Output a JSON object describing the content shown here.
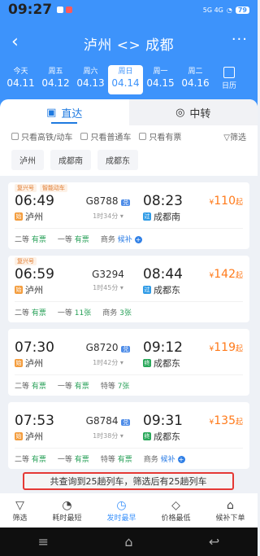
{
  "status": {
    "time": "09:27",
    "signal": "5G 4G",
    "battery": "79"
  },
  "title": "泸州 <> 成都",
  "header": {
    "back": "‹",
    "more": "···"
  },
  "dates": [
    {
      "w": "今天",
      "d": "04.11",
      "active": false
    },
    {
      "w": "周五",
      "d": "04.12",
      "active": false
    },
    {
      "w": "周六",
      "d": "04.13",
      "active": false
    },
    {
      "w": "周日",
      "d": "04.14",
      "active": true
    },
    {
      "w": "周一",
      "d": "04.15",
      "active": false
    },
    {
      "w": "周二",
      "d": "04.16",
      "active": false
    }
  ],
  "calendar_label": "日历",
  "tabs": {
    "direct": "直达",
    "transfer": "中转"
  },
  "filters": {
    "gaotie": "只看高铁/动车",
    "putong": "只看普通车",
    "youpiao": "只看有票",
    "screen": "筛选"
  },
  "stations": [
    "泸州",
    "成都南",
    "成都东"
  ],
  "trains": [
    {
      "tags": [
        "复兴号",
        "智能动车"
      ],
      "dep_time": "06:49",
      "dep_station": "泸州",
      "dep_type": "始",
      "no": "G8788",
      "badge": "兑",
      "dur": "1时34分",
      "arr_time": "08:23",
      "arr_station": "成都南",
      "arr_type": "过",
      "price": "110",
      "price_suffix": "起",
      "seats": [
        {
          "cls": "二等",
          "status": "有票",
          "t": "ok"
        },
        {
          "cls": "一等",
          "status": "有票",
          "t": "ok"
        },
        {
          "cls": "商务",
          "status": "候补",
          "t": "alt"
        }
      ]
    },
    {
      "tags": [
        "复兴号"
      ],
      "dep_time": "06:59",
      "dep_station": "泸州",
      "dep_type": "始",
      "no": "G3294",
      "badge": "",
      "dur": "1时45分",
      "arr_time": "08:44",
      "arr_station": "成都东",
      "arr_type": "过",
      "price": "142",
      "price_suffix": "起",
      "seats": [
        {
          "cls": "二等",
          "status": "有票",
          "t": "ok"
        },
        {
          "cls": "一等",
          "status": "11张",
          "t": "ok"
        },
        {
          "cls": "商务",
          "status": "3张",
          "t": "ok"
        }
      ]
    },
    {
      "tags": [],
      "dep_time": "07:30",
      "dep_station": "泸州",
      "dep_type": "始",
      "no": "G8720",
      "badge": "兑",
      "dur": "1时42分",
      "arr_time": "09:12",
      "arr_station": "成都东",
      "arr_type": "终",
      "price": "119",
      "price_suffix": "起",
      "seats": [
        {
          "cls": "二等",
          "status": "有票",
          "t": "ok"
        },
        {
          "cls": "一等",
          "status": "有票",
          "t": "ok"
        },
        {
          "cls": "特等",
          "status": "7张",
          "t": "ok"
        }
      ]
    },
    {
      "tags": [],
      "dep_time": "07:53",
      "dep_station": "泸州",
      "dep_type": "始",
      "no": "G8784",
      "badge": "兑",
      "dur": "1时38分",
      "arr_time": "09:31",
      "arr_station": "成都东",
      "arr_type": "终",
      "price": "135",
      "price_suffix": "起",
      "seats": [
        {
          "cls": "二等",
          "status": "有票",
          "t": "ok"
        },
        {
          "cls": "一等",
          "status": "有票",
          "t": "ok"
        },
        {
          "cls": "特等",
          "status": "有票",
          "t": "ok"
        },
        {
          "cls": "商务",
          "status": "候补",
          "t": "alt"
        }
      ]
    }
  ],
  "notice": "共查询到25趟列车，筛选后有25趟列车",
  "bottom": [
    {
      "icon": "▽",
      "label": "筛选",
      "active": false
    },
    {
      "icon": "◔",
      "label": "耗时最短",
      "active": false
    },
    {
      "icon": "◷",
      "label": "发时最早",
      "active": true
    },
    {
      "icon": "◇",
      "label": "价格最低",
      "active": false
    },
    {
      "icon": "⌂",
      "label": "候补下单",
      "active": false
    }
  ],
  "nav": [
    "≡",
    "⌂",
    "↩"
  ]
}
